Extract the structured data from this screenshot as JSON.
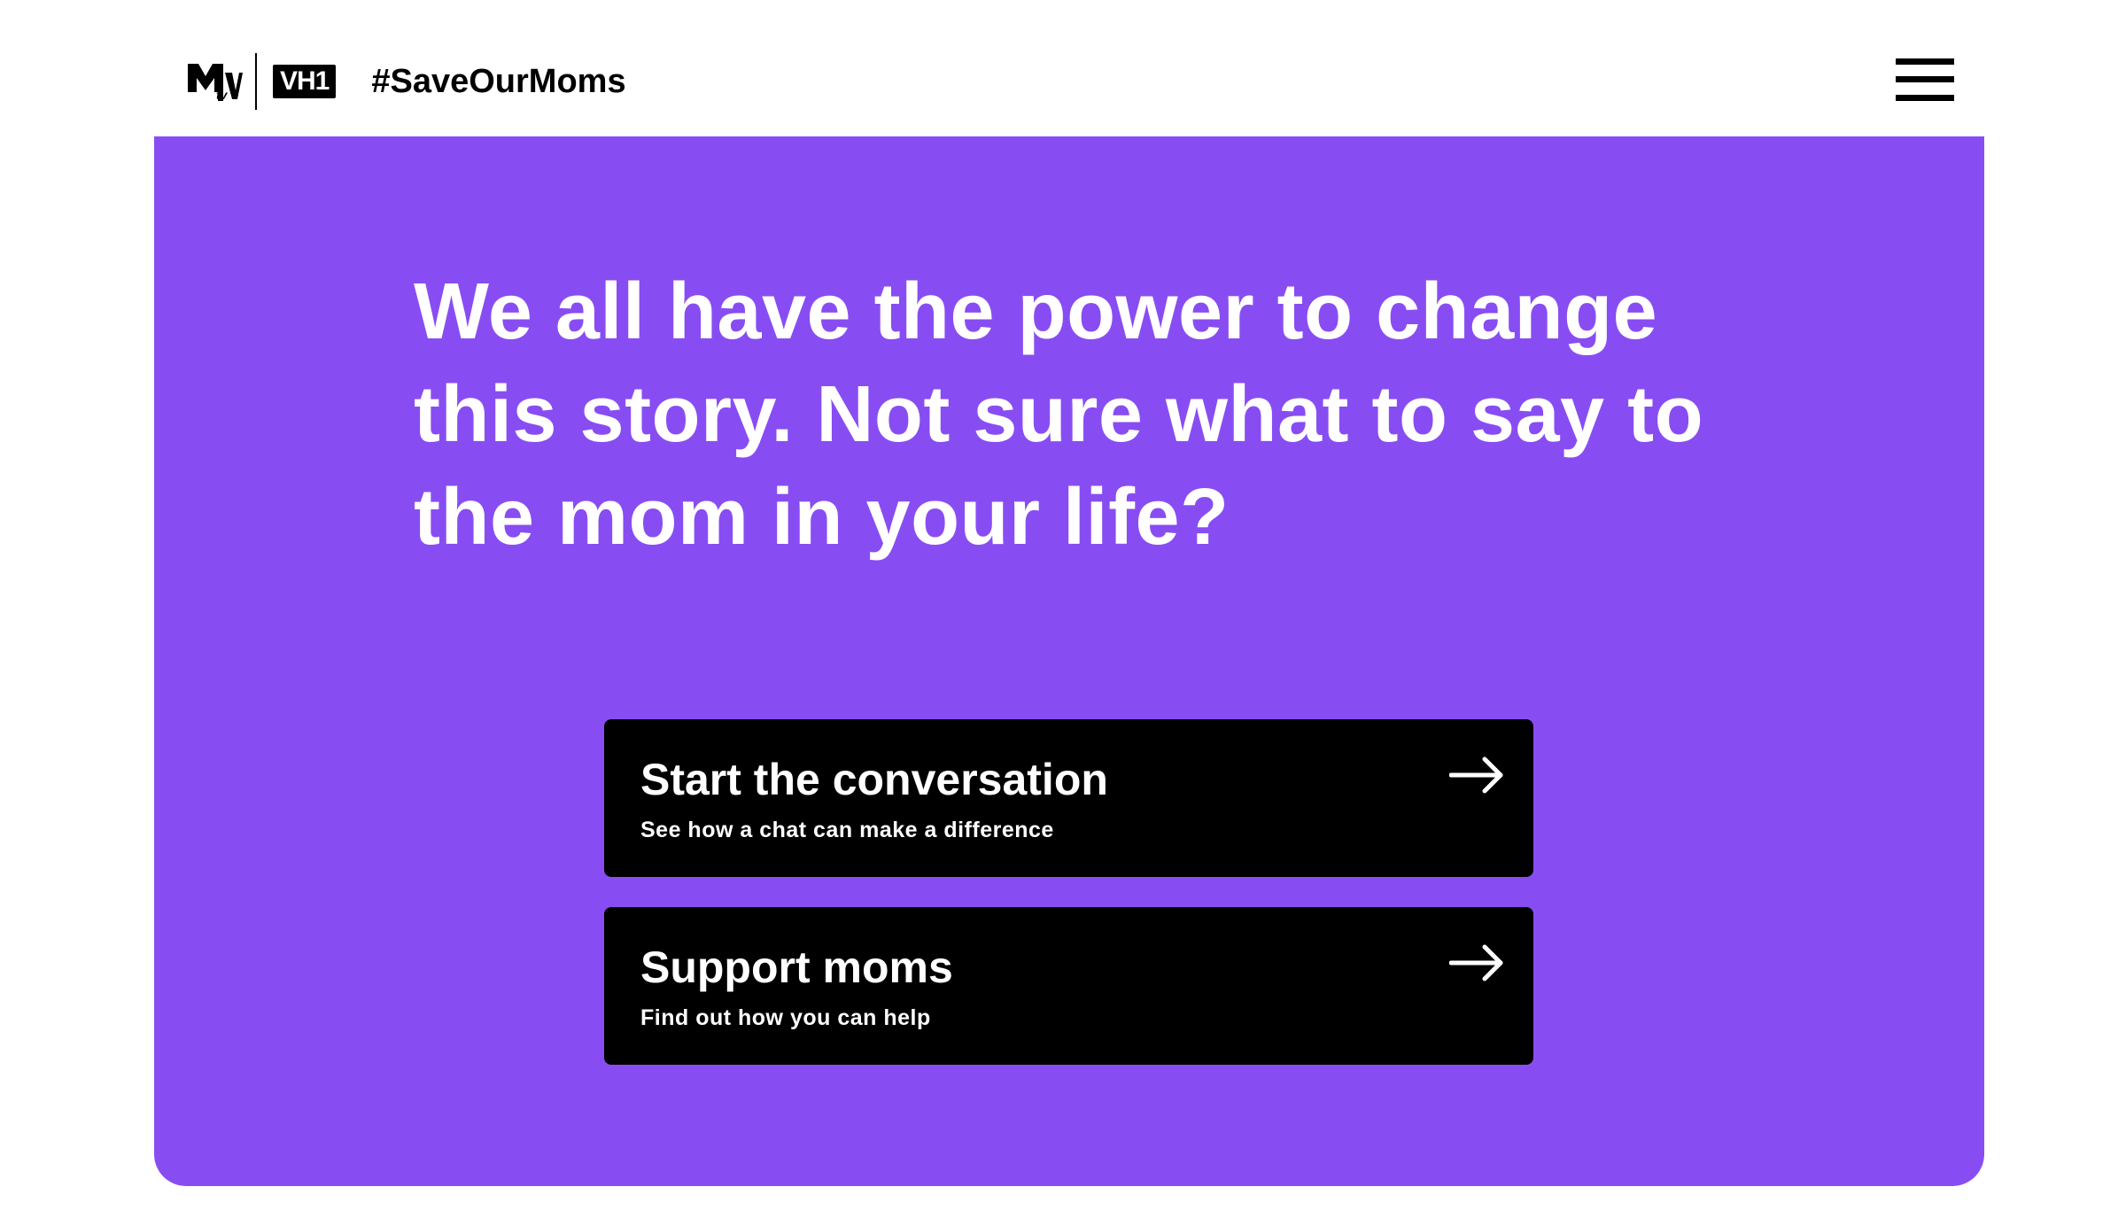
{
  "header": {
    "mtv_logo_alt": "MTV",
    "vh1_logo_text": "VH1",
    "hashtag": "#SaveOurMoms",
    "menu_icon": "hamburger-menu-icon"
  },
  "hero": {
    "background_color": "#884df2",
    "headline": "We all have the power to change this story. Not sure what to say to the mom in your life?"
  },
  "cta_buttons": [
    {
      "title": "Start the conversation",
      "subtitle": "See how a chat can make a difference",
      "icon": "arrow-right-icon"
    },
    {
      "title": "Support moms",
      "subtitle": "Find out how you can help",
      "icon": "arrow-right-icon"
    }
  ]
}
